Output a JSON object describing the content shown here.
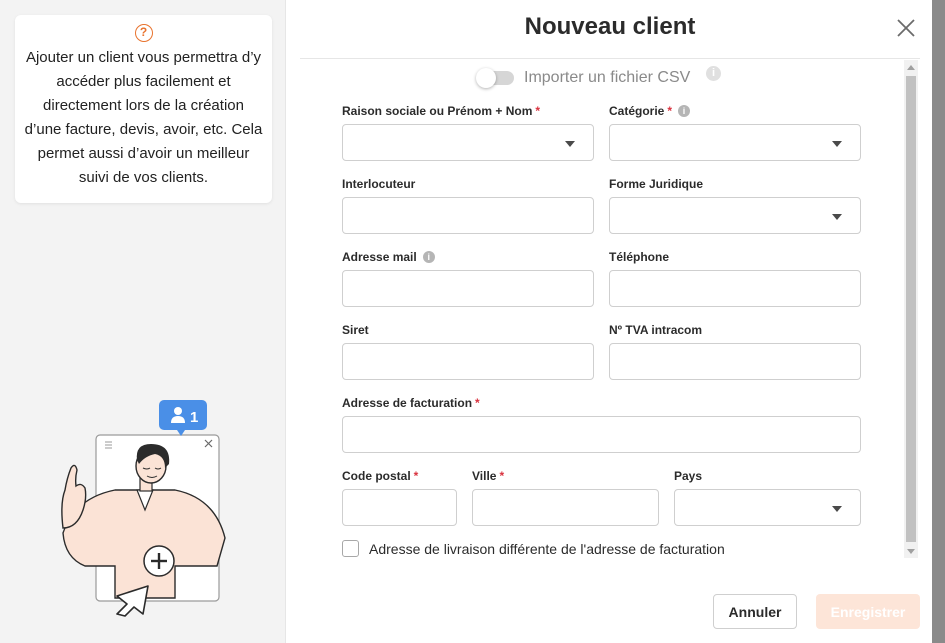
{
  "modal": {
    "title": "Nouveau client"
  },
  "left_panel": {
    "help_glyph": "?",
    "info_text": "Ajouter un client vous permettra d’y accéder plus facilement et directement lors de la création d’une facture, devis, avoir, etc. Cela permet aussi d’avoir un meilleur suivi de vos clients.",
    "illustration": {
      "badge_count": "1",
      "badge_icon": "user-icon",
      "add_glyph": "+"
    }
  },
  "import": {
    "label": "Importer un fichier CSV",
    "enabled": false,
    "info_glyph": "i"
  },
  "fields": {
    "raison_sociale": {
      "label": "Raison sociale ou Prénom + Nom",
      "required": "*",
      "value": ""
    },
    "categorie": {
      "label": "Catégorie",
      "required": "*",
      "info_glyph": "i",
      "value": ""
    },
    "interlocuteur": {
      "label": "Interlocuteur",
      "value": ""
    },
    "forme_juridique": {
      "label": "Forme Juridique",
      "value": ""
    },
    "adresse_mail": {
      "label": "Adresse mail",
      "info_glyph": "i",
      "value": ""
    },
    "telephone": {
      "label": "Téléphone",
      "value": ""
    },
    "siret": {
      "label": "Siret",
      "value": ""
    },
    "tva": {
      "label": "Nº TVA intracom",
      "value": ""
    },
    "adresse_facturation": {
      "label": "Adresse de facturation",
      "required": "*",
      "value": ""
    },
    "code_postal": {
      "label": "Code postal",
      "required": "*",
      "value": ""
    },
    "ville": {
      "label": "Ville",
      "required": "*",
      "value": ""
    },
    "pays": {
      "label": "Pays",
      "value": ""
    }
  },
  "livraison_checkbox": {
    "label": "Adresse de livraison différente de l'adresse de facturation",
    "checked": false
  },
  "actions": {
    "cancel_label": "Annuler",
    "save_label": "Enregistrer"
  },
  "colors": {
    "accent_orange": "#e8732e",
    "required_red": "#d9333f",
    "save_disabled": "#fde5d8",
    "badge_blue": "#4a8fe7"
  }
}
